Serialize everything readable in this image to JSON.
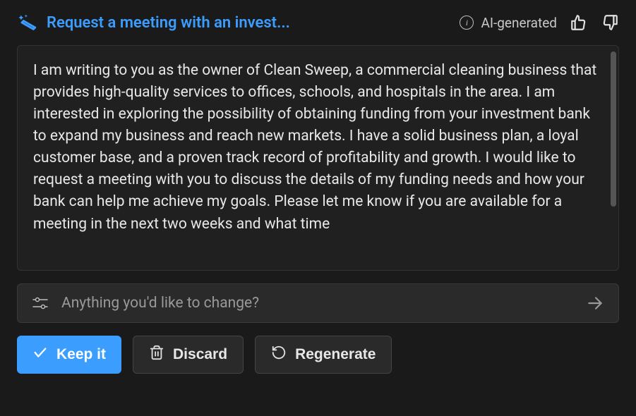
{
  "header": {
    "title": "Request a meeting with an invest...",
    "ai_label": "AI-generated"
  },
  "content": {
    "text": "I am writing to you as the owner of Clean Sweep, a commercial cleaning business that provides high-quality services to offices, schools, and hospitals in the area. I am interested in exploring the possibility of obtaining funding from your investment bank to expand my business and reach new markets. I have a solid business plan, a loyal customer base, and a proven track record of profitability and growth. I would like to request a meeting with you to discuss the details of my funding needs and how your bank can help me achieve my goals. Please let me know if you are available for a meeting in the next two weeks and what time"
  },
  "input": {
    "placeholder": "Anything you'd like to change?"
  },
  "buttons": {
    "keep": "Keep it",
    "discard": "Discard",
    "regenerate": "Regenerate"
  }
}
